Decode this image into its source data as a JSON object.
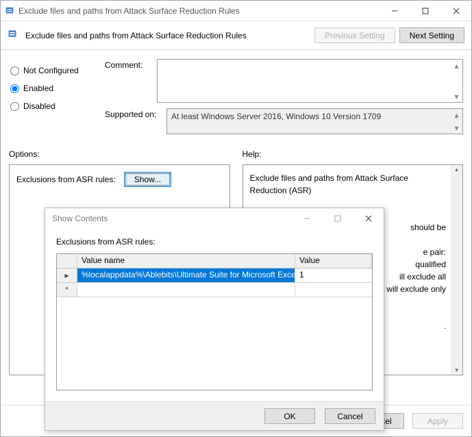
{
  "window": {
    "title": "Exclude files and paths from Attack Surface Reduction Rules"
  },
  "header": {
    "title": "Exclude files and paths from Attack Surface Reduction Rules",
    "prev_label": "Previous Setting",
    "next_label": "Next Setting"
  },
  "radios": {
    "not_configured": "Not Configured",
    "enabled": "Enabled",
    "disabled": "Disabled"
  },
  "fields": {
    "comment_label": "Comment:",
    "supported_label": "Supported on:",
    "supported_value": "At least Windows Server 2016, Windows 10 Version 1709"
  },
  "columns": {
    "options_label": "Options:",
    "help_label": "Help:"
  },
  "options": {
    "exclusions_label": "Exclusions from ASR rules:",
    "show_button": "Show..."
  },
  "help": {
    "line1": "Exclude files and paths from Attack Surface Reduction (ASR)",
    "line2": "should be",
    "line3": "e pair:",
    "line4": "qualified",
    "line5": "ill exclude all",
    "line6": "will exclude only",
    "line7": "."
  },
  "footer": {
    "ok": "OK",
    "cancel": "Cancel",
    "apply": "Apply"
  },
  "dialog": {
    "title": "Show Contents",
    "label": "Exclusions from ASR rules:",
    "col_valuename": "Value name",
    "col_value": "Value",
    "rows": [
      {
        "marker": "▸",
        "name": "%localappdata%\\Ablebits\\Ultimate Suite for Microsoft Excel",
        "value": "1",
        "selected": true
      },
      {
        "marker": "*",
        "name": "",
        "value": "",
        "selected": false
      }
    ],
    "ok": "OK",
    "cancel": "Cancel"
  }
}
